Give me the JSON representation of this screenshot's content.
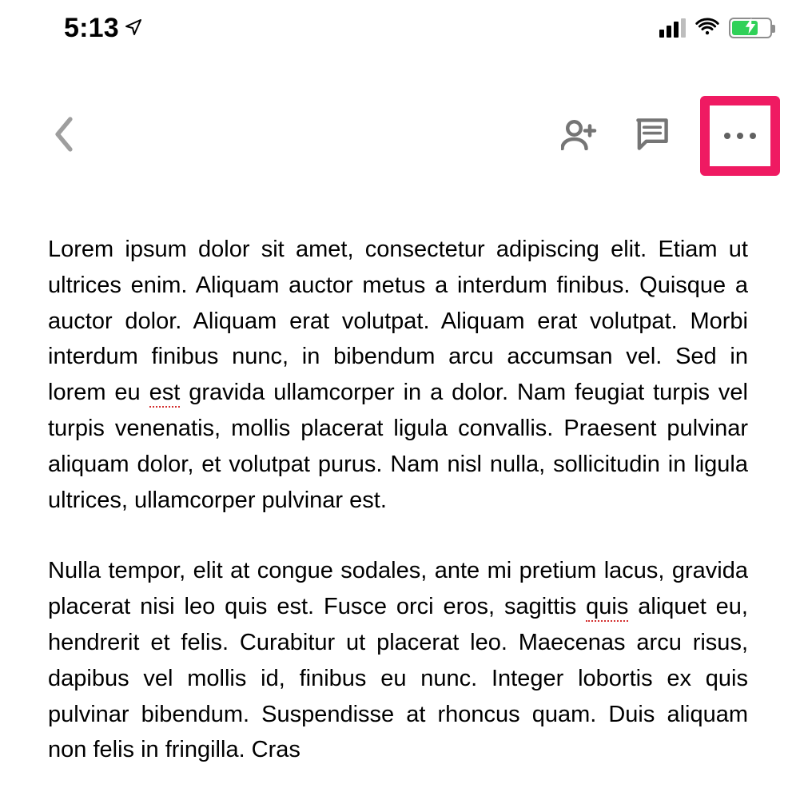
{
  "status_bar": {
    "time": "5:13",
    "location_icon": "location-arrow-icon",
    "signal_label": "signal-icon",
    "wifi_label": "wifi-icon",
    "battery_label": "battery-charging-icon"
  },
  "nav": {
    "back_label": "back-icon",
    "add_person_label": "add-person-icon",
    "comment_label": "comment-icon",
    "more_label": "more-icon"
  },
  "document": {
    "p1_a": "Lorem ipsum dolor sit amet, consectetur adipiscing elit. Etiam ut ultrices enim. Aliquam auctor metus a interdum finibus. Quisque a auctor dolor. Aliquam erat volutpat. Aliquam erat volutpat. Morbi interdum finibus nunc, in bibendum arcu accumsan vel. Sed in lorem eu ",
    "p1_err1": "est",
    "p1_b": " gravida ullamcorper in a dolor. Nam feugiat turpis vel turpis venenatis, mollis placerat ligula convallis. Praesent pulvinar aliquam dolor, et volutpat purus. Nam nisl nulla, sollicitudin in ligula ultrices, ullamcorper pulvinar est.",
    "p2_a": "Nulla tempor, elit at congue sodales, ante mi pretium lacus, gravida placerat nisi leo quis est. Fusce orci eros, sagittis ",
    "p2_err1": "quis",
    "p2_b": " aliquet eu, hendrerit et felis. Curabitur ut placerat leo. Maecenas arcu risus, dapibus vel mollis id, finibus eu nunc. Integer lobortis ex quis pulvinar bibendum. Suspendisse at rhoncus quam. Duis aliquam non felis in fringilla. Cras"
  },
  "colors": {
    "highlight": "#ef1a62",
    "icon_gray": "#757575",
    "battery_green": "#30d158"
  }
}
